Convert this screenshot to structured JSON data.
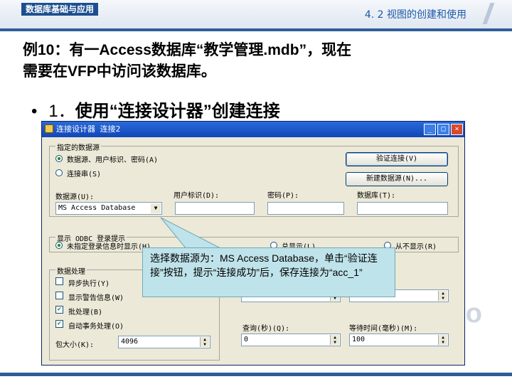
{
  "header": {
    "brand": "数据库基础与应用",
    "section_title": "4. 2  视图的创建和使用"
  },
  "intro": {
    "line1": "例10：有一Access数据库“教学管理.mdb”，现在",
    "line2": "需要在VFP中访问该数据库。"
  },
  "bullet": {
    "number": "1．",
    "text": "使用“连接设计器”创建连接"
  },
  "dialog": {
    "title": "连接设计器  连接2",
    "specify_group": {
      "label": "指定的数据源",
      "options": [
        "数据源、用户标识、密码(A)",
        "连接串(S)"
      ],
      "verify_button": "验证连接(V)",
      "new_datasource_button": "新建数据源(N)...",
      "datasource_label": "数据源(U):",
      "datasource_value": "MS Access Database",
      "userid_label": "用户标识(D):",
      "password_label": "密码(P):",
      "database_label": "数据库(T):"
    },
    "odbc_group": {
      "label": "显示 ODBC 登录提示",
      "options": [
        "未指定登录信息时显示(H)",
        "总显示(L)",
        "从不显示(R)"
      ]
    },
    "processing_group": {
      "label": "数据处理",
      "checks": [
        {
          "label": "异步执行(Y)",
          "checked": false
        },
        {
          "label": "显示警告信息(W)",
          "checked": false
        },
        {
          "label": "批处理(B)",
          "checked": true
        },
        {
          "label": "自动事务处理(O)",
          "checked": true
        }
      ],
      "packet_label": "包大小(K):",
      "packet_value": "4096"
    },
    "query_label": "查询(秒)(Q):",
    "query_value": "0",
    "wait_label": "等待时间(毫秒)(M):",
    "wait_value": "100"
  },
  "callout": {
    "text": "选择数据源为：MS Access Database，单击“验证连接”按钮，提示“连接成功”后，保存连接为“acc_1”"
  },
  "watermark": "ro"
}
